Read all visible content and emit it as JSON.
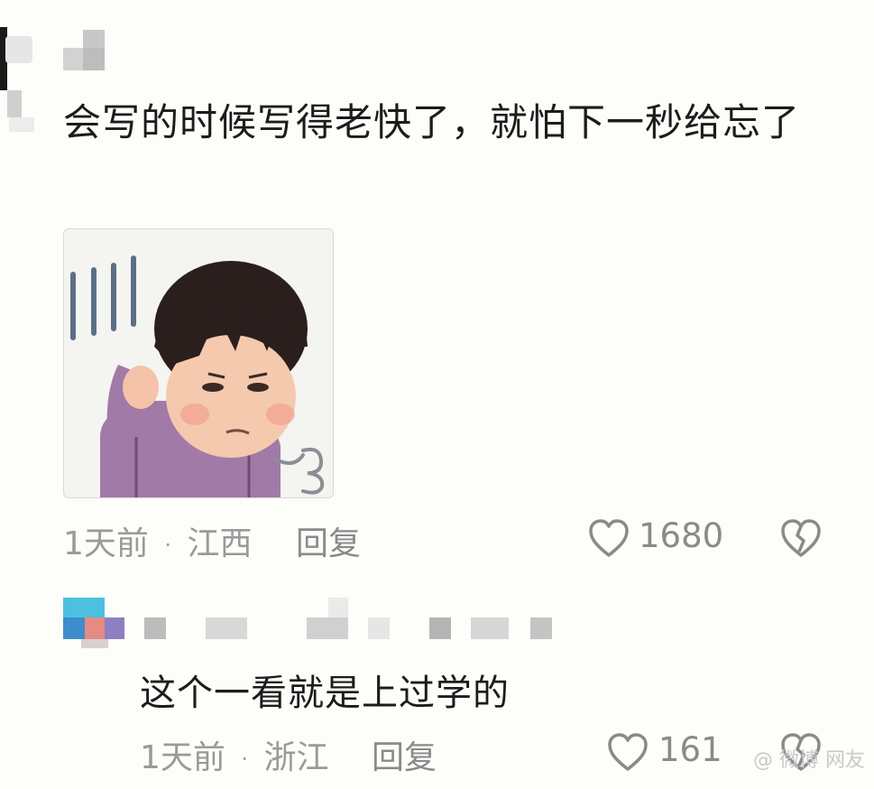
{
  "comment": {
    "text": "会写的时候写得老快了，就怕下一秒给忘了",
    "time": "1天前",
    "location": "江西",
    "reply_label": "回复",
    "likes": "1680"
  },
  "reply": {
    "text": "这个一看就是上过学的",
    "time": "1天前",
    "location": "浙江",
    "reply_label": "回复",
    "likes": "161"
  },
  "separator": "·",
  "watermark": "@ 微博 网友",
  "colors": {
    "text_primary": "#1c1c1c",
    "text_meta": "#9a9a9a",
    "icon_gray": "#8a8a8a",
    "background": "#fdfdf9"
  }
}
